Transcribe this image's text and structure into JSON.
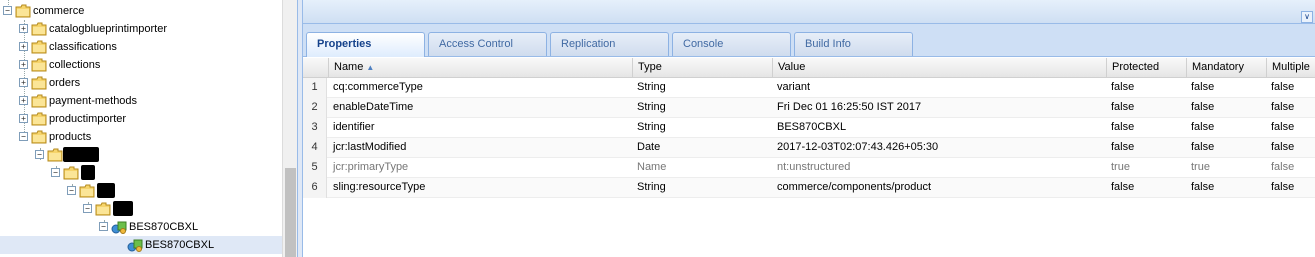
{
  "tree": {
    "nodes": [
      {
        "label": "commerce",
        "toggle": "−"
      },
      {
        "label": "catalogblueprintimporter",
        "toggle": "+"
      },
      {
        "label": "classifications",
        "toggle": "+"
      },
      {
        "label": "collections",
        "toggle": "+"
      },
      {
        "label": "orders",
        "toggle": "+"
      },
      {
        "label": "payment-methods",
        "toggle": "+"
      },
      {
        "label": "productimporter",
        "toggle": "+"
      },
      {
        "label": "products",
        "toggle": "−"
      },
      {
        "label": "",
        "toggle": "−"
      },
      {
        "label": "",
        "toggle": "−"
      },
      {
        "label": "",
        "toggle": "−"
      },
      {
        "label": "",
        "toggle": "−"
      },
      {
        "label": "BES870CBXL",
        "toggle": "−"
      },
      {
        "label": "BES870CBXL",
        "toggle": ""
      }
    ]
  },
  "tabs": [
    "Properties",
    "Access Control",
    "Replication",
    "Console",
    "Build Info"
  ],
  "columns": [
    "Name",
    "Type",
    "Value",
    "Protected",
    "Mandatory",
    "Multiple"
  ],
  "rows": [
    {
      "num": "1",
      "name": "cq:commerceType",
      "type": "String",
      "value": "variant",
      "protected": "false",
      "mandatory": "false",
      "multiple": "false"
    },
    {
      "num": "2",
      "name": "enableDateTime",
      "type": "String",
      "value": "Fri Dec 01 16:25:50 IST 2017",
      "protected": "false",
      "mandatory": "false",
      "multiple": "false"
    },
    {
      "num": "3",
      "name": "identifier",
      "type": "String",
      "value": "BES870CBXL",
      "protected": "false",
      "mandatory": "false",
      "multiple": "false"
    },
    {
      "num": "4",
      "name": "jcr:lastModified",
      "type": "Date",
      "value": "2017-12-03T02:07:43.426+05:30",
      "protected": "false",
      "mandatory": "false",
      "multiple": "false"
    },
    {
      "num": "5",
      "name": "jcr:primaryType",
      "type": "Name",
      "value": "nt:unstructured",
      "protected": "true",
      "mandatory": "true",
      "multiple": "false"
    },
    {
      "num": "6",
      "name": "sling:resourceType",
      "type": "String",
      "value": "commerce/components/product",
      "protected": "false",
      "mandatory": "false",
      "multiple": "false"
    }
  ],
  "colors": {
    "accent": "#15428b",
    "selection": "#dfe8f6",
    "tab_border": "#8db2e3"
  },
  "icons": {
    "folder": "folder-icon",
    "product": "product-node-icon",
    "collapse": "double-chevron-down-icon",
    "sort": "sort-ascending-icon"
  }
}
